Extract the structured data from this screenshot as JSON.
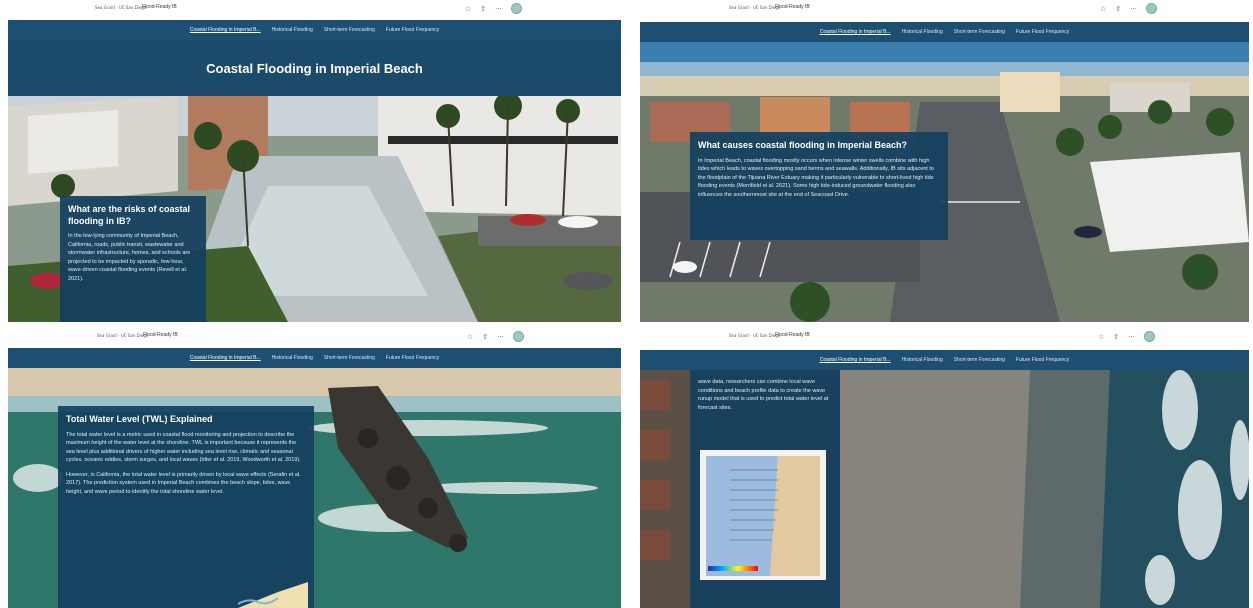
{
  "window": {
    "site_title": "Flood-Ready IB",
    "logos_text": "Sea Grant · UC San Diego",
    "icons": [
      "star-icon",
      "share-icon",
      "more-icon",
      "avatar"
    ],
    "more_glyph": "···",
    "star_glyph": "☆",
    "share_glyph": "⇧"
  },
  "nav": {
    "items": [
      {
        "label": "Coastal Flooding in Imperial B..."
      },
      {
        "label": "Historical Flooding"
      },
      {
        "label": "Short-term Forecasting"
      },
      {
        "label": "Future Flood Frequency"
      }
    ]
  },
  "panel1": {
    "page_title": "Coastal Flooding in Imperial Beach",
    "card_title": "What are the risks of coastal flooding in IB?",
    "card_text": "In the low-lying community of Imperial Beach, California, roads, public transit, wastewater and stormwater infrastructure, homes, and schools are projected to be impacted by sporadic, few-hour, wave-driven coastal flooding events (Revell et al. 2021)."
  },
  "panel2": {
    "card_title": "What causes coastal flooding in Imperial Beach?",
    "card_text": "In Imperial Beach, coastal flooding mostly occurs when intense winter swells combine with high tides which leads to waves overtopping sand berms and seawalls. Additionally, IB sits adjacent to the floodplain of the Tijuana River Estuary making it particularly vulnerable to short-lived high tide flooding events (Merrifield et al. 2021). Some high tide-induced groundwater flooding also influences the southernmost site at the end of Seacoast Drive."
  },
  "panel3": {
    "card_title": "Total Water Level (TWL) Explained",
    "card_text_1": "The total water level is a metric used in coastal flood monitoring and projection to describe the maximum height of the water level at the shoreline. TWL is important because it represents the sea level plus additional drivers of higher water including sea level rise, climatic and seasonal cycles, oceanic eddies, storm surges, and local waves (Idier et al. 2019, Woodworth et al. 2019).",
    "card_text_2": "However, in California, the total water level is primarily driven by local wave effects (Serafin et al. 2017). The prediction system used in Imperial Beach combines the beach slope, tides, wave height, and wave period to identify the total shoreline water level."
  },
  "panel4": {
    "card_text": "wave data, researchers can combine local wave conditions and beach profile data to create the wave runup model that is used to predict total water level at forecast sites."
  }
}
